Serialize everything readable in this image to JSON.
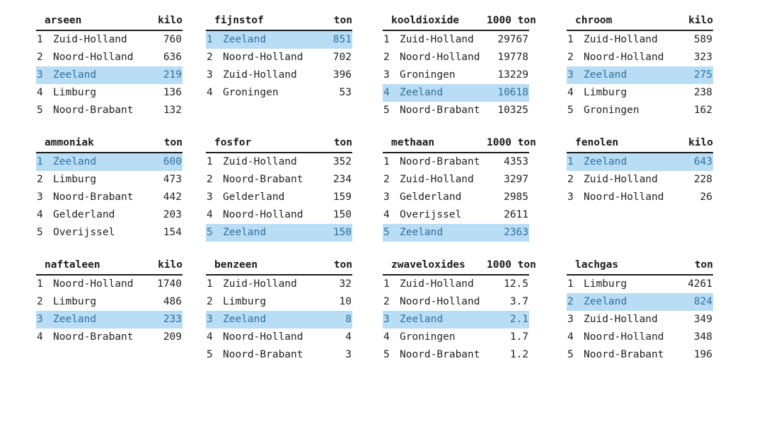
{
  "page": {
    "background_color": "#ffffff",
    "text_color": "#222222",
    "highlight_background": "#b9ddf4",
    "highlight_text_color": "#2f6f9f",
    "rule_color": "#1a1a1a"
  },
  "tables": [
    {
      "name": "arseen",
      "unit": "kilo",
      "rows": [
        {
          "rank": "1",
          "region": "Zuid-Holland",
          "value": "760",
          "highlight": false
        },
        {
          "rank": "2",
          "region": "Noord-Holland",
          "value": "636",
          "highlight": false
        },
        {
          "rank": "3",
          "region": "Zeeland",
          "value": "219",
          "highlight": true
        },
        {
          "rank": "4",
          "region": "Limburg",
          "value": "136",
          "highlight": false
        },
        {
          "rank": "5",
          "region": "Noord-Brabant",
          "value": "132",
          "highlight": false
        }
      ]
    },
    {
      "name": "fijnstof",
      "unit": "ton",
      "rows": [
        {
          "rank": "1",
          "region": "Zeeland",
          "value": "851",
          "highlight": true
        },
        {
          "rank": "2",
          "region": "Noord-Holland",
          "value": "702",
          "highlight": false
        },
        {
          "rank": "3",
          "region": "Zuid-Holland",
          "value": "396",
          "highlight": false
        },
        {
          "rank": "4",
          "region": "Groningen",
          "value": "53",
          "highlight": false
        }
      ]
    },
    {
      "name": "kooldioxide",
      "unit": "1000 ton",
      "rows": [
        {
          "rank": "1",
          "region": "Zuid-Holland",
          "value": "29767",
          "highlight": false
        },
        {
          "rank": "2",
          "region": "Noord-Holland",
          "value": "19778",
          "highlight": false
        },
        {
          "rank": "3",
          "region": "Groningen",
          "value": "13229",
          "highlight": false
        },
        {
          "rank": "4",
          "region": "Zeeland",
          "value": "10618",
          "highlight": true
        },
        {
          "rank": "5",
          "region": "Noord-Brabant",
          "value": "10325",
          "highlight": false
        }
      ]
    },
    {
      "name": "chroom",
      "unit": "kilo",
      "rows": [
        {
          "rank": "1",
          "region": "Zuid-Holland",
          "value": "589",
          "highlight": false
        },
        {
          "rank": "2",
          "region": "Noord-Holland",
          "value": "323",
          "highlight": false
        },
        {
          "rank": "3",
          "region": "Zeeland",
          "value": "275",
          "highlight": true
        },
        {
          "rank": "4",
          "region": "Limburg",
          "value": "238",
          "highlight": false
        },
        {
          "rank": "5",
          "region": "Groningen",
          "value": "162",
          "highlight": false
        }
      ]
    },
    {
      "name": "ammoniak",
      "unit": "ton",
      "rows": [
        {
          "rank": "1",
          "region": "Zeeland",
          "value": "600",
          "highlight": true
        },
        {
          "rank": "2",
          "region": "Limburg",
          "value": "473",
          "highlight": false
        },
        {
          "rank": "3",
          "region": "Noord-Brabant",
          "value": "442",
          "highlight": false
        },
        {
          "rank": "4",
          "region": "Gelderland",
          "value": "203",
          "highlight": false
        },
        {
          "rank": "5",
          "region": "Overijssel",
          "value": "154",
          "highlight": false
        }
      ]
    },
    {
      "name": "fosfor",
      "unit": "ton",
      "rows": [
        {
          "rank": "1",
          "region": "Zuid-Holland",
          "value": "352",
          "highlight": false
        },
        {
          "rank": "2",
          "region": "Noord-Brabant",
          "value": "234",
          "highlight": false
        },
        {
          "rank": "3",
          "region": "Gelderland",
          "value": "159",
          "highlight": false
        },
        {
          "rank": "4",
          "region": "Noord-Holland",
          "value": "150",
          "highlight": false
        },
        {
          "rank": "5",
          "region": "Zeeland",
          "value": "150",
          "highlight": true
        }
      ]
    },
    {
      "name": "methaan",
      "unit": "1000 ton",
      "rows": [
        {
          "rank": "1",
          "region": "Noord-Brabant",
          "value": "4353",
          "highlight": false
        },
        {
          "rank": "2",
          "region": "Zuid-Holland",
          "value": "3297",
          "highlight": false
        },
        {
          "rank": "3",
          "region": "Gelderland",
          "value": "2985",
          "highlight": false
        },
        {
          "rank": "4",
          "region": "Overijssel",
          "value": "2611",
          "highlight": false
        },
        {
          "rank": "5",
          "region": "Zeeland",
          "value": "2363",
          "highlight": true
        }
      ]
    },
    {
      "name": "fenolen",
      "unit": "kilo",
      "rows": [
        {
          "rank": "1",
          "region": "Zeeland",
          "value": "643",
          "highlight": true
        },
        {
          "rank": "2",
          "region": "Zuid-Holland",
          "value": "228",
          "highlight": false
        },
        {
          "rank": "3",
          "region": "Noord-Holland",
          "value": "26",
          "highlight": false
        }
      ]
    },
    {
      "name": "naftaleen",
      "unit": "kilo",
      "rows": [
        {
          "rank": "1",
          "region": "Noord-Holland",
          "value": "1740",
          "highlight": false
        },
        {
          "rank": "2",
          "region": "Limburg",
          "value": "486",
          "highlight": false
        },
        {
          "rank": "3",
          "region": "Zeeland",
          "value": "233",
          "highlight": true
        },
        {
          "rank": "4",
          "region": "Noord-Brabant",
          "value": "209",
          "highlight": false
        }
      ]
    },
    {
      "name": "benzeen",
      "unit": "ton",
      "rows": [
        {
          "rank": "1",
          "region": "Zuid-Holland",
          "value": "32",
          "highlight": false
        },
        {
          "rank": "2",
          "region": "Limburg",
          "value": "10",
          "highlight": false
        },
        {
          "rank": "3",
          "region": "Zeeland",
          "value": "8",
          "highlight": true
        },
        {
          "rank": "4",
          "region": "Noord-Holland",
          "value": "4",
          "highlight": false
        },
        {
          "rank": "5",
          "region": "Noord-Brabant",
          "value": "3",
          "highlight": false
        }
      ]
    },
    {
      "name": "zwaveloxides",
      "unit": "1000 ton",
      "rows": [
        {
          "rank": "1",
          "region": "Zuid-Holland",
          "value": "12.5",
          "highlight": false
        },
        {
          "rank": "2",
          "region": "Noord-Holland",
          "value": "3.7",
          "highlight": false
        },
        {
          "rank": "3",
          "region": "Zeeland",
          "value": "2.1",
          "highlight": true
        },
        {
          "rank": "4",
          "region": "Groningen",
          "value": "1.7",
          "highlight": false
        },
        {
          "rank": "5",
          "region": "Noord-Brabant",
          "value": "1.2",
          "highlight": false
        }
      ]
    },
    {
      "name": "lachgas",
      "unit": "ton",
      "rows": [
        {
          "rank": "1",
          "region": "Limburg",
          "value": "4261",
          "highlight": false
        },
        {
          "rank": "2",
          "region": "Zeeland",
          "value": "824",
          "highlight": true
        },
        {
          "rank": "3",
          "region": "Zuid-Holland",
          "value": "349",
          "highlight": false
        },
        {
          "rank": "4",
          "region": "Noord-Holland",
          "value": "348",
          "highlight": false
        },
        {
          "rank": "5",
          "region": "Noord-Brabant",
          "value": "196",
          "highlight": false
        }
      ]
    }
  ]
}
